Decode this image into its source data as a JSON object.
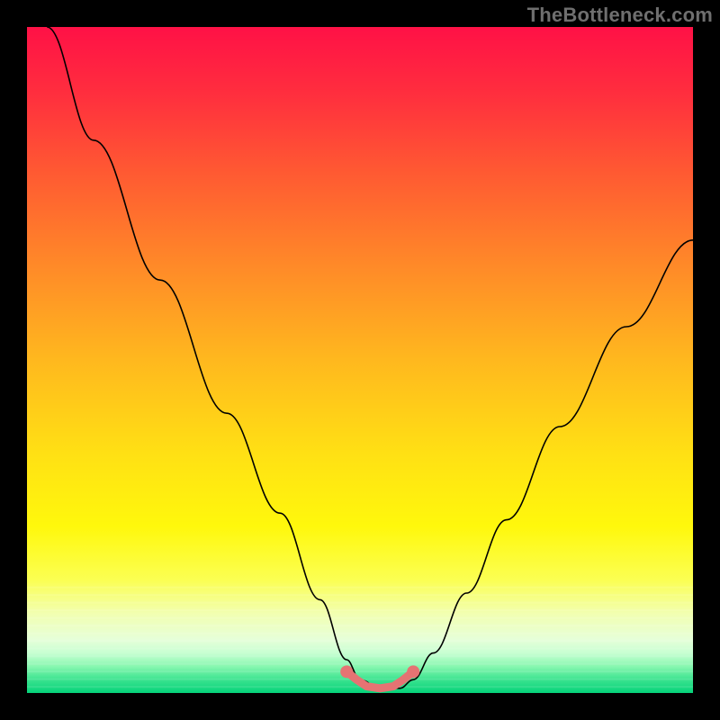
{
  "source_label": "TheBottleneck.com",
  "chart_data": {
    "type": "line",
    "title": "",
    "xlabel": "",
    "ylabel": "",
    "xlim": [
      0,
      100
    ],
    "ylim": [
      0,
      100
    ],
    "series": [
      {
        "name": "curve",
        "x": [
          3,
          10,
          20,
          30,
          38,
          44,
          48,
          50,
          53,
          56,
          58,
          61,
          66,
          72,
          80,
          90,
          100
        ],
        "y": [
          100,
          83,
          62,
          42,
          27,
          14,
          5,
          2,
          0.7,
          0.7,
          2,
          6,
          15,
          26,
          40,
          55,
          68
        ]
      },
      {
        "name": "marker-band",
        "x": [
          48,
          49.5,
          51,
          53,
          55,
          56.5,
          58
        ],
        "y": [
          3.2,
          2.0,
          1.0,
          0.7,
          1.0,
          2.0,
          3.2
        ]
      }
    ],
    "line_color": "#000000",
    "marker_color": "#e57373"
  }
}
